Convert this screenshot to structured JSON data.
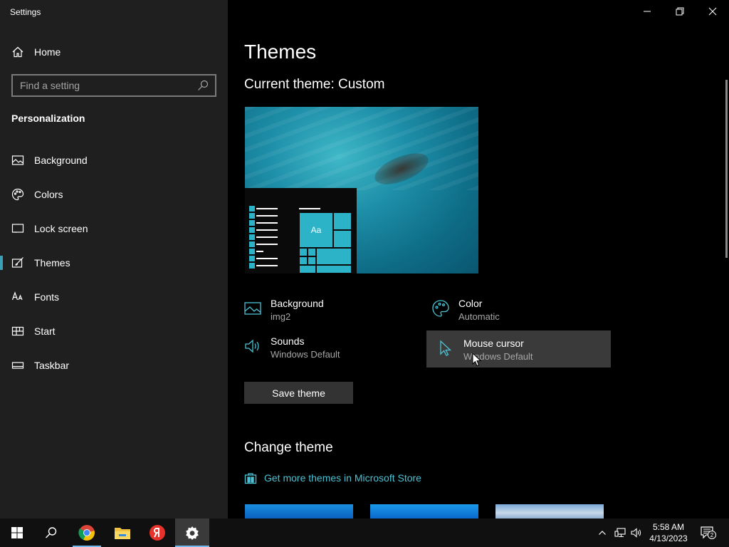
{
  "window": {
    "title": "Settings"
  },
  "sidebar": {
    "home_label": "Home",
    "search_placeholder": "Find a setting",
    "section_title": "Personalization",
    "items": [
      {
        "label": "Background",
        "icon": "picture-icon"
      },
      {
        "label": "Colors",
        "icon": "palette-icon"
      },
      {
        "label": "Lock screen",
        "icon": "lock-screen-icon"
      },
      {
        "label": "Themes",
        "icon": "themes-icon",
        "active": true
      },
      {
        "label": "Fonts",
        "icon": "fonts-icon"
      },
      {
        "label": "Start",
        "icon": "start-icon"
      },
      {
        "label": "Taskbar",
        "icon": "taskbar-icon"
      }
    ]
  },
  "main": {
    "page_title": "Themes",
    "current_theme": "Current theme: Custom",
    "preview_tile_label": "Aa",
    "properties": {
      "background": {
        "name": "Background",
        "value": "img2"
      },
      "color": {
        "name": "Color",
        "value": "Automatic"
      },
      "sounds": {
        "name": "Sounds",
        "value": "Windows Default"
      },
      "mouse_cursor": {
        "name": "Mouse cursor",
        "value": "Windows Default"
      }
    },
    "save_button": "Save theme",
    "change_theme_title": "Change theme",
    "store_link": "Get more themes in Microsoft Store"
  },
  "taskbar": {
    "apps": [
      "start-icon",
      "search-icon",
      "chrome-icon",
      "file-explorer-icon",
      "yandex-icon",
      "settings-icon"
    ],
    "clock": {
      "time": "5:58 AM",
      "date": "4/13/2023"
    },
    "notification_count": "2"
  },
  "colors": {
    "accent": "#2db3c7",
    "link": "#4cc2d4",
    "sidebar_bg": "#1f1f1f",
    "main_bg": "#000000"
  }
}
